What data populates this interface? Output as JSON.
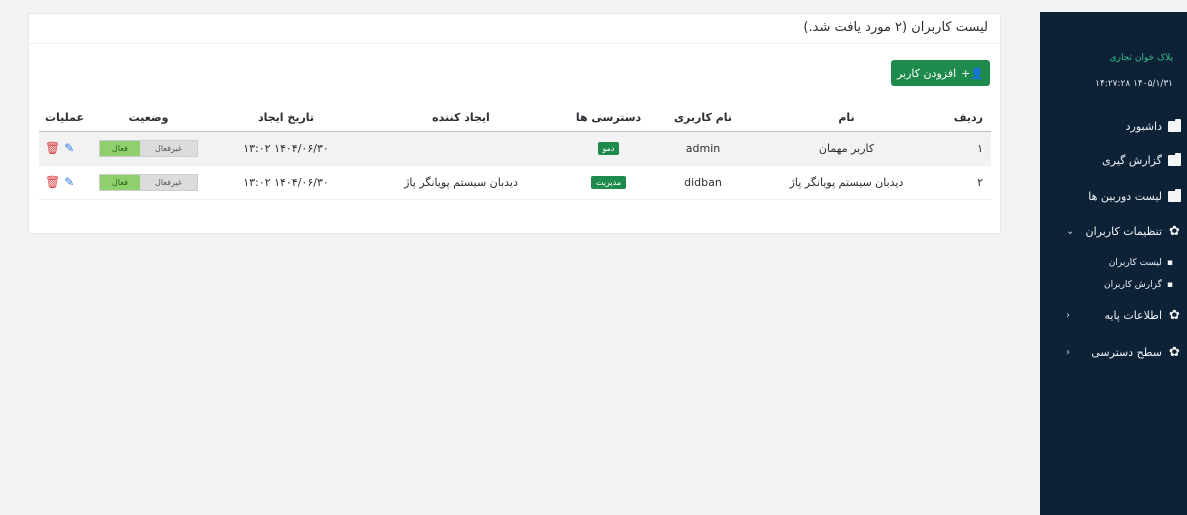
{
  "sidebar": {
    "brand": "پلاک خوان تجاری",
    "clock": "۱۴۰۵/۱/۳۱ ۱۴:۲۷:۲۸",
    "items": [
      {
        "label": "داشبورد",
        "icon": "folder-icon"
      },
      {
        "label": "گزارش گیری",
        "icon": "folder-icon"
      },
      {
        "label": "لیست دوربین ها",
        "icon": "folder-icon"
      },
      {
        "label": "تنظیمات کاربران",
        "icon": "gear-icon",
        "caret": "⌄"
      },
      {
        "label": "اطلاعات پایه",
        "icon": "gear-icon",
        "caret": "‹"
      },
      {
        "label": "سطح دسترسی",
        "icon": "gear-icon",
        "caret": "‹"
      }
    ],
    "subitems": [
      {
        "label": "لیست کاربران",
        "icon": "users-icon"
      },
      {
        "label": "گزارش کاربران",
        "icon": "users-icon"
      }
    ]
  },
  "card": {
    "title": "لیست کاربران (۲ مورد یافت شد.)",
    "add_button": "افزودن کاربر"
  },
  "table": {
    "headers": {
      "idx": "ردیف",
      "name": "نام",
      "username": "نام کاربری",
      "role": "دسترسی ها",
      "creator": "ایجاد کننده",
      "date": "تاریخ ایجاد",
      "status": "وضعیت",
      "ops": "عملیات"
    },
    "rows": [
      {
        "idx": "۱",
        "name": "کاربر مهمان",
        "username": "admin",
        "role": "دمو",
        "creator": "",
        "date": "۱۴۰۴/۰۶/۳۰ ۱۳:۰۲",
        "status_on": "فعال",
        "status_off": "غیرفعال"
      },
      {
        "idx": "۲",
        "name": "دیدبان سیستم پویانگر پاژ",
        "username": "didban",
        "role": "مدیریت",
        "creator": "دیدبان سیستم پویانگر پاژ",
        "date": "۱۴۰۴/۰۶/۳۰ ۱۳:۰۲",
        "status_on": "فعال",
        "status_off": "غیرفعال"
      }
    ]
  },
  "colors": {
    "sidebar_bg": "#0e2237",
    "brand_green": "#1e8a4c",
    "toggle_on": "#8fd06c",
    "delete_red": "#d93a3a",
    "edit_blue": "#2f7be6"
  }
}
